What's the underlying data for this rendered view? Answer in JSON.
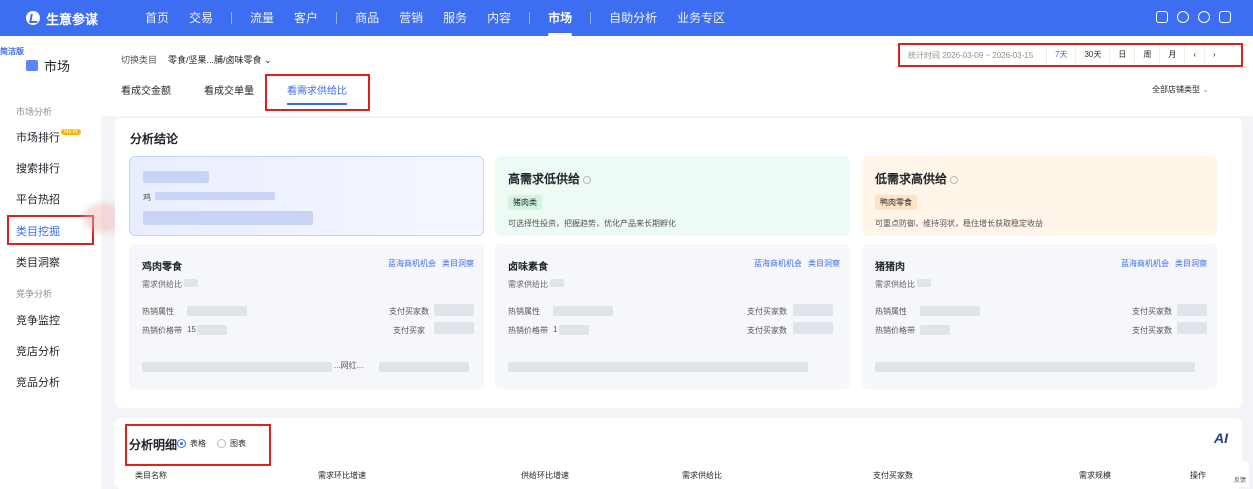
{
  "app": {
    "name": "生意参谋"
  },
  "nav": {
    "items": [
      "首页",
      "交易",
      "流量",
      "客户",
      "商品",
      "营销",
      "服务",
      "内容",
      "市场",
      "自助分析",
      "业务专区"
    ],
    "active": "市场"
  },
  "sidebar": {
    "tag": "简洁版",
    "title": "市场",
    "group1": "市场分析",
    "items1": [
      "市场排行",
      "搜索排行",
      "平台热招",
      "类目挖掘",
      "类目洞察"
    ],
    "new_badge": "NEW",
    "group2": "竞争分析",
    "items2": [
      "竞争监控",
      "竞店分析",
      "竞品分析"
    ],
    "active": "类目挖掘"
  },
  "filter": {
    "switch_label": "切换类目",
    "switch_value": "零食/坚果...脯/卤味零食 ⌄",
    "date_range": "统计时间 2026-03-09 ~ 2026-03-15",
    "periods": [
      "7天",
      "30天",
      "日",
      "周",
      "月"
    ],
    "active_period": "7天",
    "prev": "‹",
    "next": "›",
    "shop_type": "全部店铺类型"
  },
  "tabs": {
    "items": [
      "看成交金额",
      "看成交单量",
      "看需求供给比"
    ],
    "active": "看需求供给比"
  },
  "conclusion": {
    "title": "分析结论",
    "card_blue_prefix": "鸡",
    "card_green": {
      "title": "高需求低供给",
      "tag": "猪肉类",
      "desc": "可选择性投资，把握趋势，优化产品来长期孵化"
    },
    "card_orange": {
      "title": "低需求高供给",
      "tag": "鸭肉零食",
      "desc": "可重点防御，维持羽状，稳住增长获取稳定收益"
    },
    "details": [
      {
        "name": "鸡肉零食",
        "sub": "需求供给比",
        "attr1": "热销属性",
        "attr2": "热销价格带",
        "attr2_val": "15",
        "r1": "支付买家数",
        "r2": "支付买家",
        "tail": "...网红..."
      },
      {
        "name": "卤味素食",
        "sub": "需求供给比",
        "attr1": "热销属性",
        "attr2": "热销价格带",
        "attr2_val": "1",
        "r1": "支付买家数",
        "r2": "支付买家数",
        "tail": ""
      },
      {
        "name": "猪猪肉",
        "sub": "需求供给比",
        "attr1": "热销属性",
        "attr2": "热销价格带",
        "attr2_val": "",
        "r1": "支付买家数",
        "r2": "支付买家数",
        "tail": ""
      }
    ],
    "links": [
      "蓝海商机机会",
      "类目洞察"
    ]
  },
  "detail_table": {
    "title": "分析明细",
    "views": [
      "表格",
      "图表"
    ],
    "active_view": "表格",
    "columns": [
      "类目名称",
      "需求环比增速",
      "供给环比增速",
      "需求供给比",
      "支付买家数",
      "需求规模",
      "操作"
    ],
    "ai_label": "AI"
  },
  "feedback": "反馈"
}
